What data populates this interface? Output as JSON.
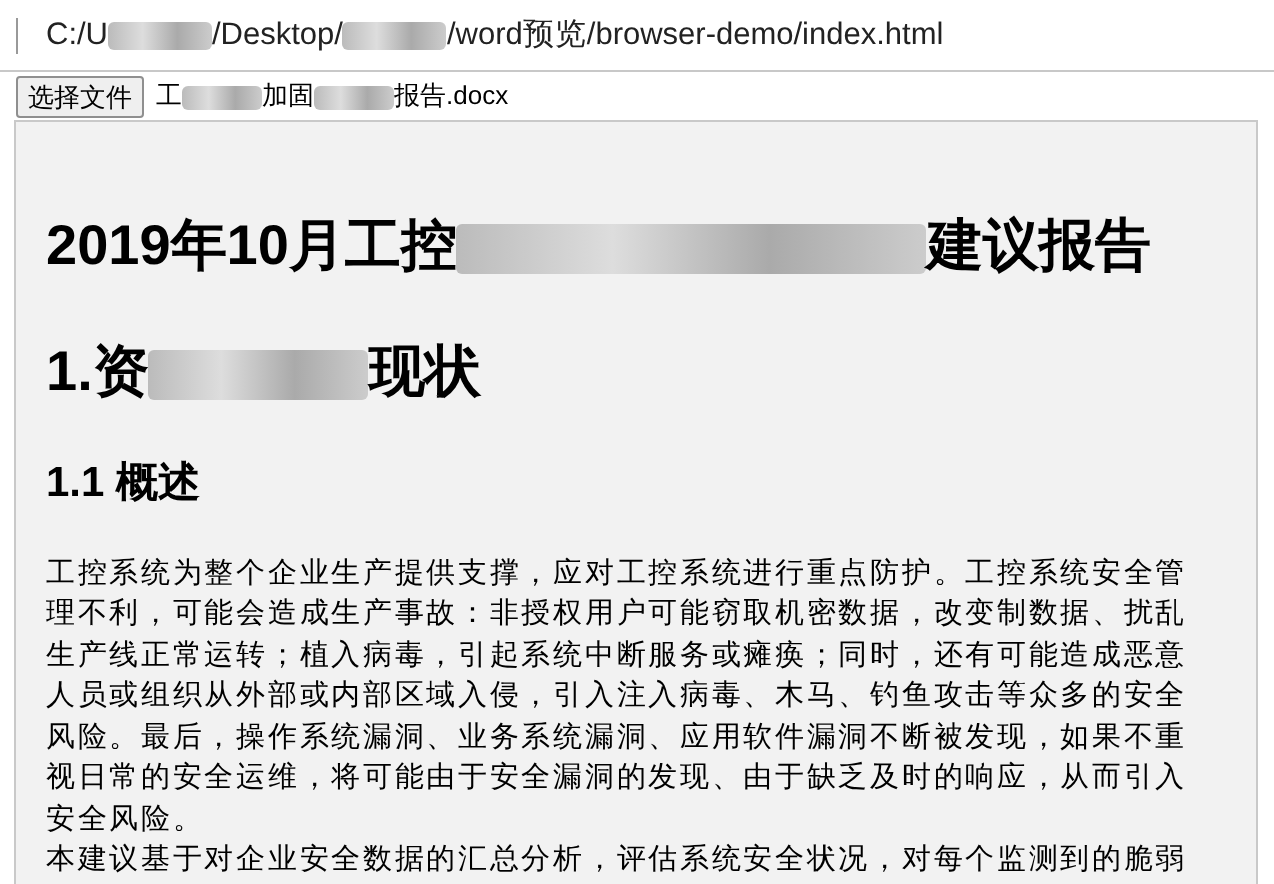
{
  "address_bar": {
    "url_parts": [
      {
        "kind": "text",
        "text": "C:/U"
      },
      {
        "kind": "redacted"
      },
      {
        "kind": "text",
        "text": "/Desktop/"
      },
      {
        "kind": "redacted"
      },
      {
        "kind": "text",
        "text": "/word预览/browser-demo/index.html"
      }
    ]
  },
  "file_input": {
    "button": "选择文件",
    "file_name_parts": [
      {
        "kind": "text",
        "text": "工"
      },
      {
        "kind": "redacted"
      },
      {
        "kind": "text",
        "text": "加固"
      },
      {
        "kind": "redacted"
      },
      {
        "kind": "text",
        "text": "报告.docx"
      }
    ]
  },
  "document": {
    "blocks": [
      {
        "kind": "h1",
        "parts": [
          {
            "kind": "text",
            "text": "2019年10月工控"
          },
          {
            "kind": "redacted"
          },
          {
            "kind": "text",
            "text": "建议报告"
          }
        ]
      },
      {
        "kind": "h2",
        "parts": [
          {
            "kind": "text",
            "text": "1.资"
          },
          {
            "kind": "redacted"
          },
          {
            "kind": "text",
            "text": "现状"
          }
        ]
      },
      {
        "kind": "h3",
        "parts": [
          {
            "kind": "text",
            "text": "1.1 概述"
          }
        ]
      },
      {
        "kind": "p",
        "lines": [
          "工控系统为整个企业生产提供支撑，应对工控系统进行重点防护。工控系统安全管",
          "理不利，可能会造成生产事故：非授权用户可能窃取机密数据，改变制数据、扰乱",
          "生产线正常运转；植入病毒，引起系统中断服务或瘫痪；同时，还有可能造成恶意",
          "人员或组织从外部或内部区域入侵，引入注入病毒、木马、钓鱼攻击等众多的安全",
          "风险。最后，操作系统漏洞、业务系统漏洞、应用软件漏洞不断被发现，如果不重",
          "视日常的安全运维，将可能由于安全漏洞的发现、由于缺乏及时的响应，从而引入",
          "安全风险。"
        ]
      },
      {
        "kind": "p",
        "lines": [
          "本建议基于对企业安全数据的汇总分析，评估系统安全状况，对每个监测到的脆弱"
        ]
      }
    ]
  }
}
